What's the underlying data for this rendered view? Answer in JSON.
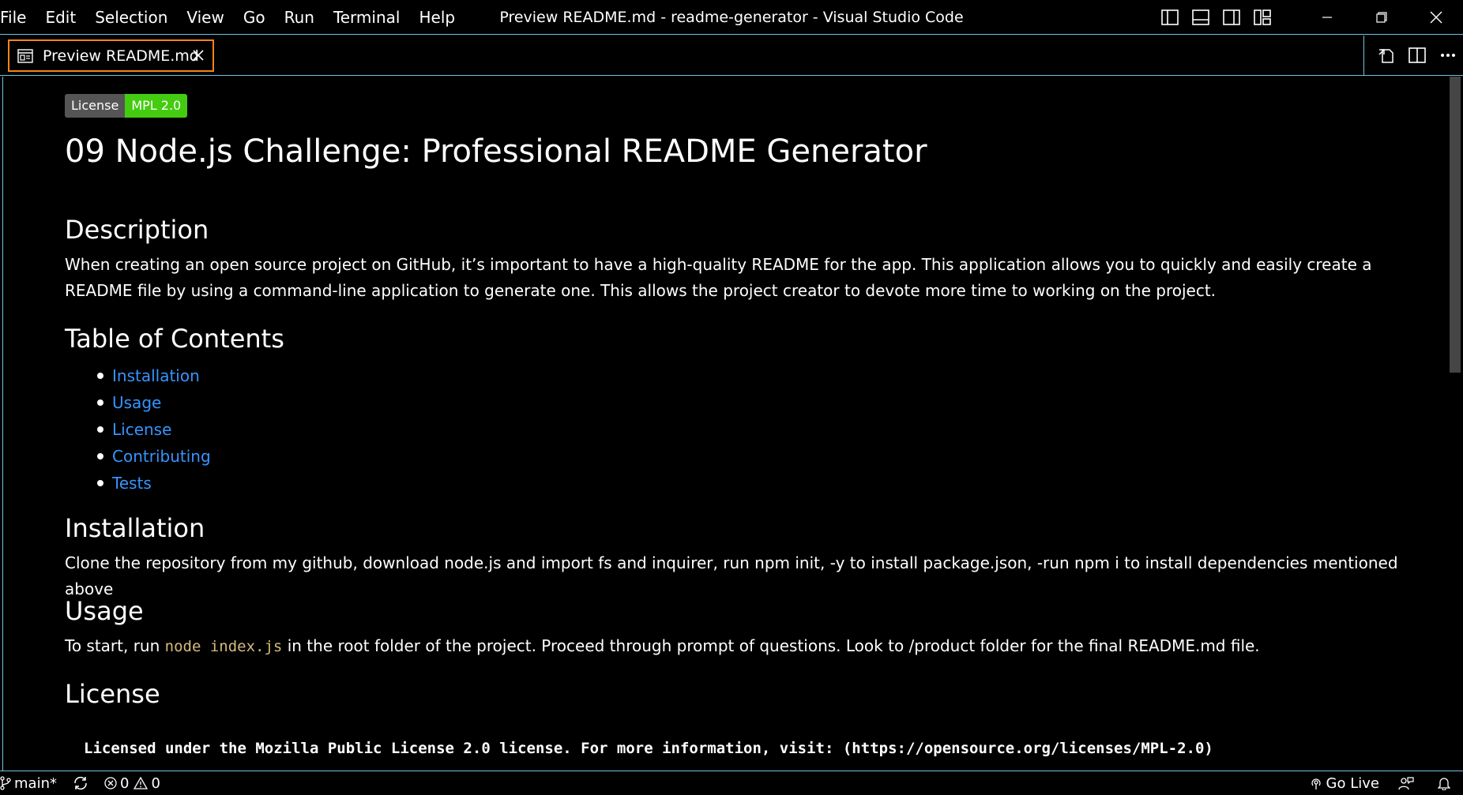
{
  "titlebar": {
    "menu": [
      "File",
      "Edit",
      "Selection",
      "View",
      "Go",
      "Run",
      "Terminal",
      "Help"
    ],
    "window_title": "Preview README.md - readme-generator - Visual Studio Code"
  },
  "tab": {
    "label": "Preview README.md"
  },
  "preview": {
    "badge_label": "License",
    "badge_value": "MPL 2.0",
    "title": "09 Node.js Challenge: Professional README Generator",
    "description_heading": "Description",
    "description_text": "When creating an open source project on GitHub, it’s important to have a high-quality README for the app. This application allows you to quickly and easily create a README file by using a command-line application to generate one. This allows the project creator to devote more time to working on the project.",
    "toc_heading": "Table of Contents",
    "toc": [
      "Installation",
      "Usage",
      "License",
      "Contributing",
      "Tests"
    ],
    "installation_heading": "Installation",
    "installation_text": "Clone the repository from my github, download node.js and import fs and inquirer, run npm init, -y to install package.json, -run npm i to install dependencies mentioned above",
    "usage_heading": "Usage",
    "usage_before": "To start, run ",
    "usage_code": "node index.js",
    "usage_after": " in the root folder of the project. Proceed through prompt of questions. Look to /product folder for the final README.md file.",
    "license_heading": "License",
    "license_code": "Licensed under the Mozilla Public License 2.0 license. For more information, visit: (https://opensource.org/licenses/MPL-2.0)"
  },
  "statusbar": {
    "branch": "main*",
    "errors": "0",
    "warnings": "0",
    "go_live": "Go Live"
  },
  "colors": {
    "focus_border": "#6fc3df",
    "active_tab_border": "#f38518",
    "link": "#3794ff",
    "badge_green": "#44cc11"
  }
}
